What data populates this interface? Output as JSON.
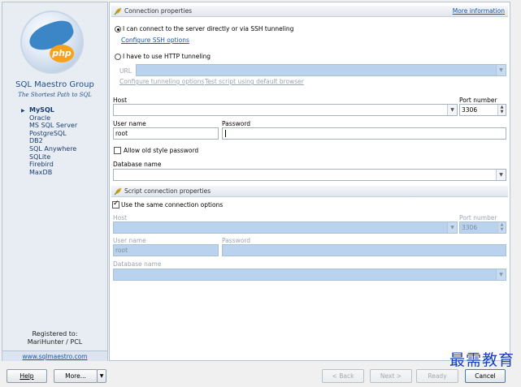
{
  "sidebar": {
    "company": "SQL Maestro Group",
    "tagline": "The Shortest Path to SQL",
    "logo_text": "php",
    "databases": [
      "MySQL",
      "Oracle",
      "MS SQL Server",
      "PostgreSQL",
      "DB2",
      "SQL Anywhere",
      "SQLite",
      "Firebird",
      "MaxDB"
    ],
    "active_database": "MySQL",
    "registered_label": "Registered to:",
    "registered_user": "MariHunter / PCL",
    "website": "www.sqlmaestro.com"
  },
  "connection": {
    "header": "Connection properties",
    "more_info": "More information",
    "direct_option": "I can connect to the server directly or via SSH tunneling",
    "ssh_link": "Configure SSH options",
    "http_option": "I have to use HTTP tunneling",
    "url_label": "URL",
    "url_value": "",
    "tunneling_link": "Configure tunneling options",
    "test_script_link": "Test script using default browser",
    "host_label": "Host",
    "host_value": "",
    "port_label": "Port number",
    "port_value": "3306",
    "user_label": "User name",
    "user_value": "root",
    "password_label": "Password",
    "password_value": "",
    "old_password_label": "Allow old style password",
    "database_label": "Database name",
    "database_value": ""
  },
  "script": {
    "header": "Script connection properties",
    "same_options_label": "Use the same connection options",
    "host_label": "Host",
    "host_value": "",
    "port_label": "Port number",
    "port_value": "3306",
    "user_label": "User name",
    "user_value": "root",
    "password_label": "Password",
    "password_value": "",
    "database_label": "Database name",
    "database_value": ""
  },
  "footer": {
    "help": "Help",
    "more": "More...",
    "back": "< Back",
    "next": "Next >",
    "ready": "Ready",
    "cancel": "Cancel"
  },
  "watermark": "最需教育",
  "colors": {
    "disabled_field": "#b9d3ee",
    "link": "#1a55b0",
    "brand": "#1f4f8a"
  },
  "icons": {
    "section": "leaf-icon",
    "combo": "chevron-down-icon",
    "spin": "spin-up-down-icon"
  }
}
